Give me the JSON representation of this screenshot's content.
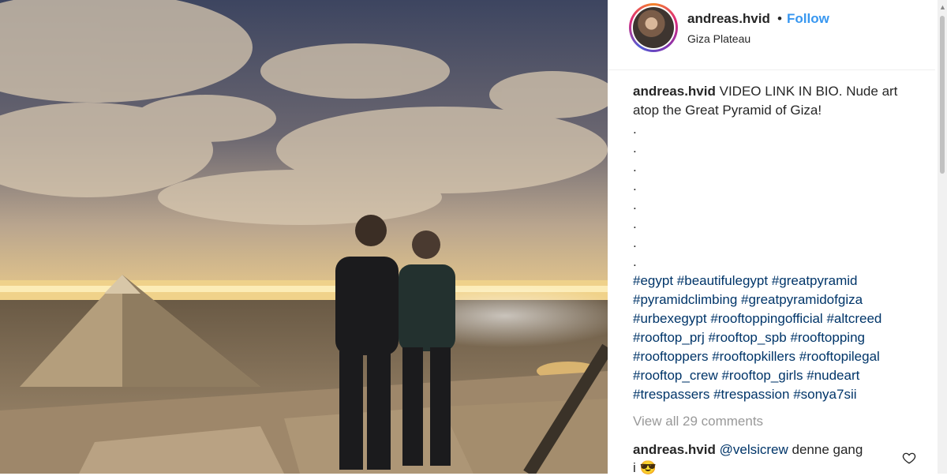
{
  "post": {
    "username": "andreas.hvid",
    "separator": "•",
    "follow_label": "Follow",
    "location": "Giza Plateau"
  },
  "caption": {
    "username": "andreas.hvid",
    "text": "VIDEO LINK IN BIO. Nude art atop the Great Pyramid of Giza!",
    "dots": [
      ".",
      ".",
      ".",
      ".",
      ".",
      ".",
      ".",
      "."
    ],
    "hashtags": [
      "#egypt",
      "#beautifulegypt",
      "#greatpyramid",
      "#pyramidclimbing",
      "#greatpyramidofgiza",
      "#urbexegypt",
      "#rooftoppingofficial",
      "#altcreed",
      "#rooftop_prj",
      "#rooftop_spb",
      "#rooftopping",
      "#rooftoppers",
      "#rooftopkillers",
      "#rooftopilegal",
      "#rooftop_crew",
      "#rooftop_girls",
      "#nudeart",
      "#trespassers",
      "#trespassion",
      "#sonya7sii"
    ]
  },
  "comments": {
    "view_all_label": "View all 29 comments",
    "first": {
      "username": "andreas.hvid",
      "mention": "@velsicrew",
      "text": "denne gang",
      "continuation": "i 😎"
    }
  },
  "icons": {
    "like": "heart-icon",
    "scroll": "scroll-up-arrow-icon"
  },
  "colors": {
    "link": "#3897f0",
    "hashtag": "#003569",
    "muted": "#999999",
    "text": "#262626"
  }
}
